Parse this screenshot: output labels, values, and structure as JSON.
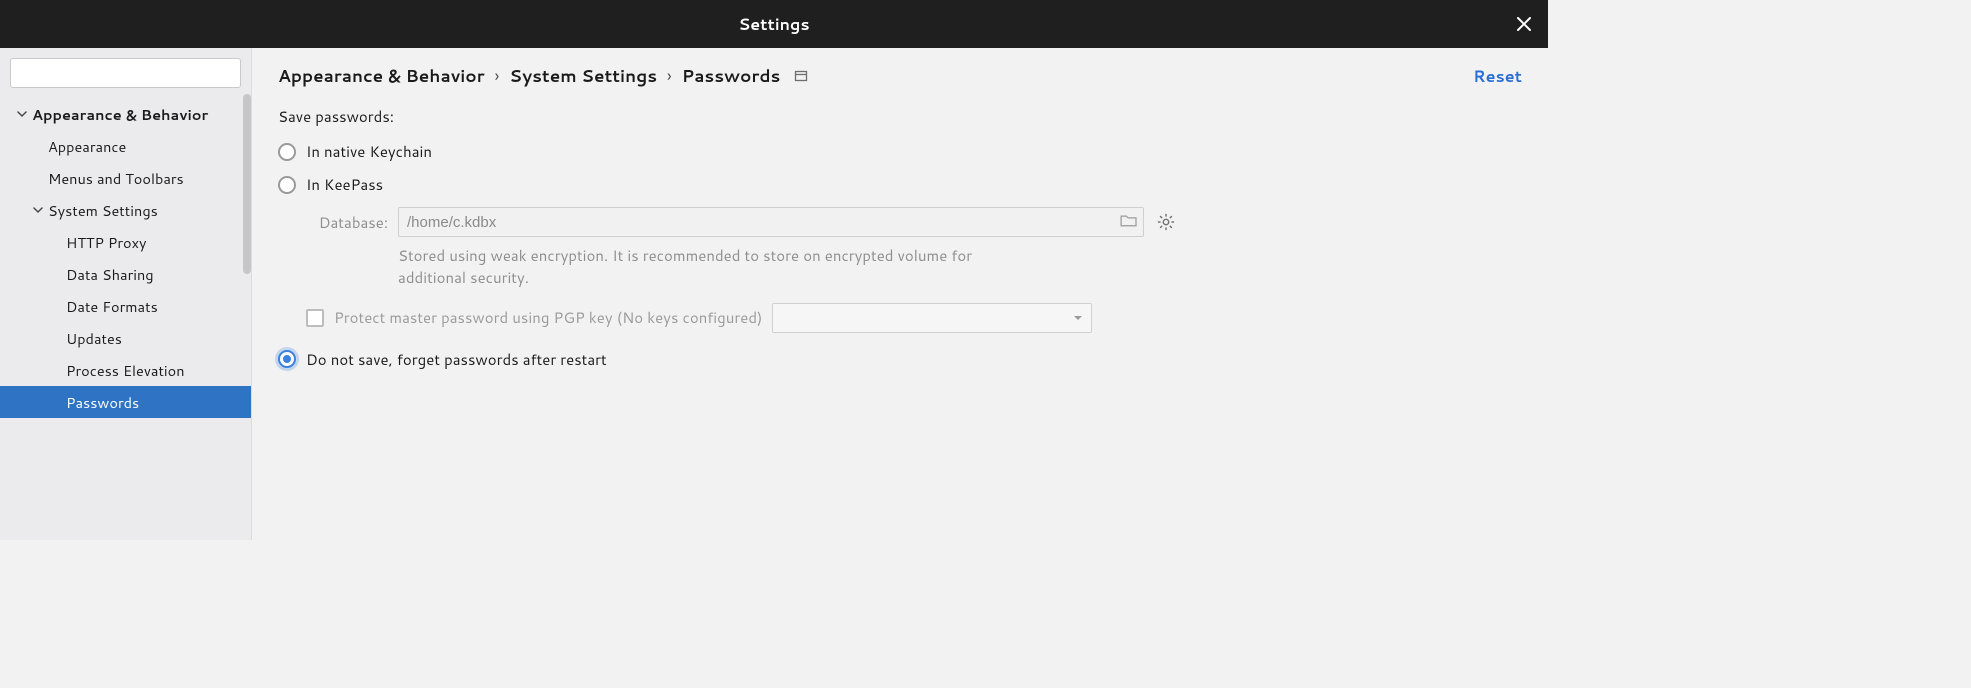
{
  "window": {
    "title": "Settings"
  },
  "sidebar": {
    "items": [
      {
        "label": "Appearance & Behavior",
        "bold": true
      },
      {
        "label": "Appearance"
      },
      {
        "label": "Menus and Toolbars"
      },
      {
        "label": "System Settings"
      },
      {
        "label": "HTTP Proxy"
      },
      {
        "label": "Data Sharing"
      },
      {
        "label": "Date Formats"
      },
      {
        "label": "Updates"
      },
      {
        "label": "Process Elevation"
      },
      {
        "label": "Passwords"
      }
    ]
  },
  "breadcrumb": {
    "a": "Appearance & Behavior",
    "b": "System Settings",
    "c": "Passwords"
  },
  "actions": {
    "reset": "Reset"
  },
  "passwords": {
    "heading": "Save passwords:",
    "opt_keychain": "In native Keychain",
    "opt_keepass": "In KeePass",
    "db_label": "Database:",
    "db_value": "/home/c.kdbx",
    "hint": "Stored using weak encryption. It is recommended to store on encrypted volume for additional security.",
    "pgp_label": "Protect master password using PGP key (No keys configured)",
    "opt_donotsave": "Do not save, forget passwords after restart"
  }
}
